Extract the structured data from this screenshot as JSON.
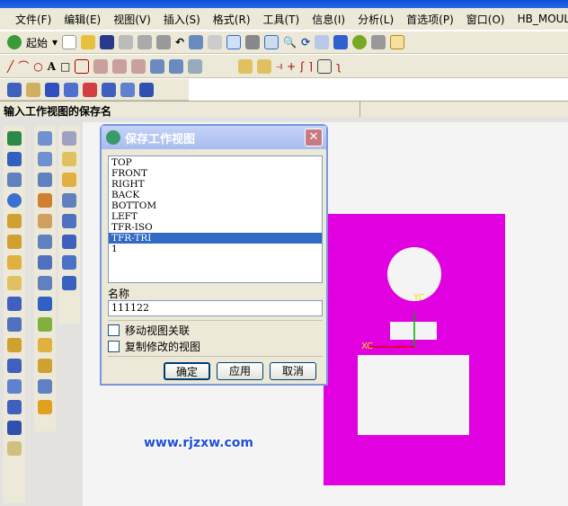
{
  "menu": [
    "文件(F)",
    "编辑(E)",
    "视图(V)",
    "插入(S)",
    "格式(R)",
    "工具(T)",
    "信息(I)",
    "分析(L)",
    "首选项(P)",
    "窗口(O)",
    "HB_MOUL"
  ],
  "toolbar": {
    "start_label": "起始"
  },
  "status": {
    "prompt": "输入工作视图的保存名"
  },
  "dialog": {
    "title": "保存工作视图",
    "close": "✕",
    "views": [
      "TOP",
      "FRONT",
      "RIGHT",
      "BACK",
      "BOTTOM",
      "LEFT",
      "TFR-ISO",
      "TFR-TRI",
      "1"
    ],
    "selected": "TFR-TRI",
    "name_label": "名称",
    "name_value": "111122",
    "checkbox1": "移动视图关联",
    "checkbox2": "复制修改的视图",
    "ok": "确定",
    "apply": "应用",
    "cancel": "取消"
  },
  "graphics": {
    "axis_y": "YC",
    "axis_x": "XC",
    "part_color": "#e000e0"
  },
  "watermark": "www.rjzxw.com"
}
